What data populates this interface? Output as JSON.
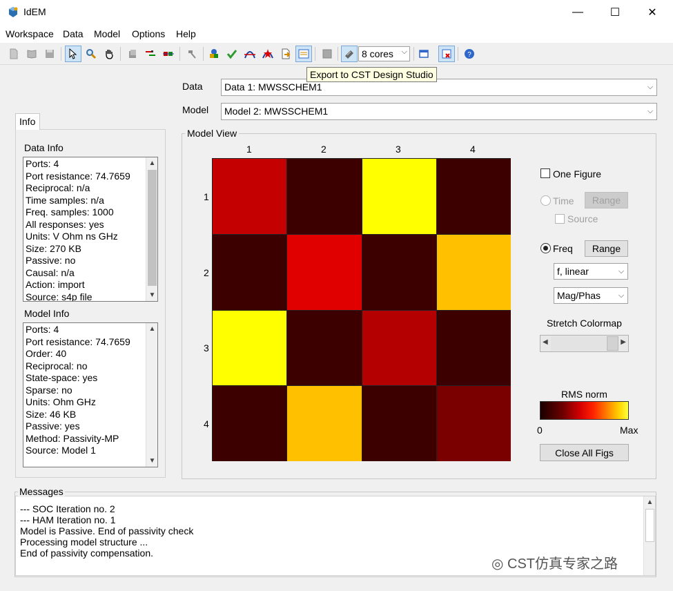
{
  "window": {
    "title": "IdEM",
    "minimize": "—",
    "maximize": "☐",
    "close": "✕"
  },
  "menu": [
    "Workspace",
    "Data",
    "Model",
    "Options",
    "Help"
  ],
  "toolbar": {
    "cores_value": "8 cores",
    "tooltip": "Export to CST Design Studio"
  },
  "selectors": {
    "data_label": "Data",
    "data_value": "Data 1: MWSSCHEM1",
    "model_label": "Model",
    "model_value": "Model 2: MWSSCHEM1"
  },
  "info": {
    "tab_label": "Info",
    "data_info_title": "Data Info",
    "data_info_lines": [
      "Ports: 4",
      "Port resistance: 74.7659",
      "Reciprocal: n/a",
      "Time samples: n/a",
      "Freq. samples: 1000",
      "All responses: yes",
      "Units: V Ohm ns GHz",
      "Size: 270 KB",
      "Passive: no",
      "Causal: n/a",
      "Action: import",
      "Source: s4p file"
    ],
    "model_info_title": "Model Info",
    "model_info_lines": [
      "Ports: 4",
      "Port resistance: 74.7659",
      "Order: 40",
      "Reciprocal: no",
      "State-space: yes",
      "Sparse: no",
      "Units: Ohm GHz",
      "Size: 46 KB",
      "Passive: yes",
      "Method: Passivity-MP",
      "Source: Model 1"
    ]
  },
  "model_view": {
    "title": "Model View",
    "col_labels": [
      "1",
      "2",
      "3",
      "4"
    ],
    "row_labels": [
      "1",
      "2",
      "3",
      "4"
    ],
    "matrix_colors": [
      [
        "#c40000",
        "#3c0000",
        "#ffff00",
        "#3c0000"
      ],
      [
        "#3c0000",
        "#e00000",
        "#3c0000",
        "#ffc000"
      ],
      [
        "#ffff00",
        "#3c0000",
        "#b40000",
        "#3c0000"
      ],
      [
        "#3c0000",
        "#ffc000",
        "#3c0000",
        "#7a0000"
      ]
    ]
  },
  "controls": {
    "one_figure_label": "One Figure",
    "time_label": "Time",
    "time_range_label": "Range",
    "source_label": "Source",
    "freq_label": "Freq",
    "freq_range_label": "Range",
    "scale_value": "f, linear",
    "format_value": "Mag/Phas",
    "stretch_label": "Stretch Colormap",
    "colorbar_title": "RMS norm",
    "colorbar_min": "0",
    "colorbar_max": "Max",
    "close_all_label": "Close All Figs"
  },
  "messages": {
    "title": "Messages",
    "lines": [
      "--- SOC Iteration no. 2",
      "--- HAM Iteration no. 1",
      "Model is Passive. End of passivity check",
      "Processing model structure ...",
      "End of passivity compensation."
    ]
  },
  "watermark": "CST仿真专家之路"
}
